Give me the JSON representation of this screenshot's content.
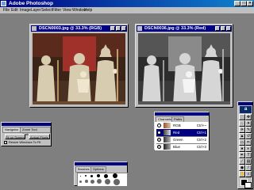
{
  "app": {
    "title": "Adobe Photoshop"
  },
  "menu": [
    "File",
    "Edit",
    "Image",
    "Layer",
    "Select",
    "Filter",
    "View",
    "Window",
    "Help"
  ],
  "documents": [
    {
      "title": "DSCN0003.jpg @ 33.3% (RGB)",
      "mode": "color"
    },
    {
      "title": "DSCN0036.jpg @ 33.3% (Red)",
      "mode": "grayscale"
    }
  ],
  "navigator": {
    "tabs": [
      "Navigator",
      "Zoom Tool Options"
    ],
    "buttons": [
      "Fit on Screen",
      "Actual Pixels"
    ],
    "checkbox_label": "Resize Windows To Fit"
  },
  "brushes": {
    "tabs": [
      "Brushes",
      "Options"
    ]
  },
  "channels": {
    "tabs": [
      "Channels",
      "Paths"
    ],
    "rows": [
      {
        "name": "RGB",
        "shortcut": "Ctrl+~"
      },
      {
        "name": "Red",
        "shortcut": "Ctrl+1"
      },
      {
        "name": "Green",
        "shortcut": "Ctrl+2"
      },
      {
        "name": "Blue",
        "shortcut": "Ctrl+3"
      }
    ]
  },
  "toolbox": {
    "logo": "a"
  },
  "colors": {
    "titlebar": "#000080",
    "chrome": "#c0c0c0",
    "workspace": "#7f7f7f"
  }
}
